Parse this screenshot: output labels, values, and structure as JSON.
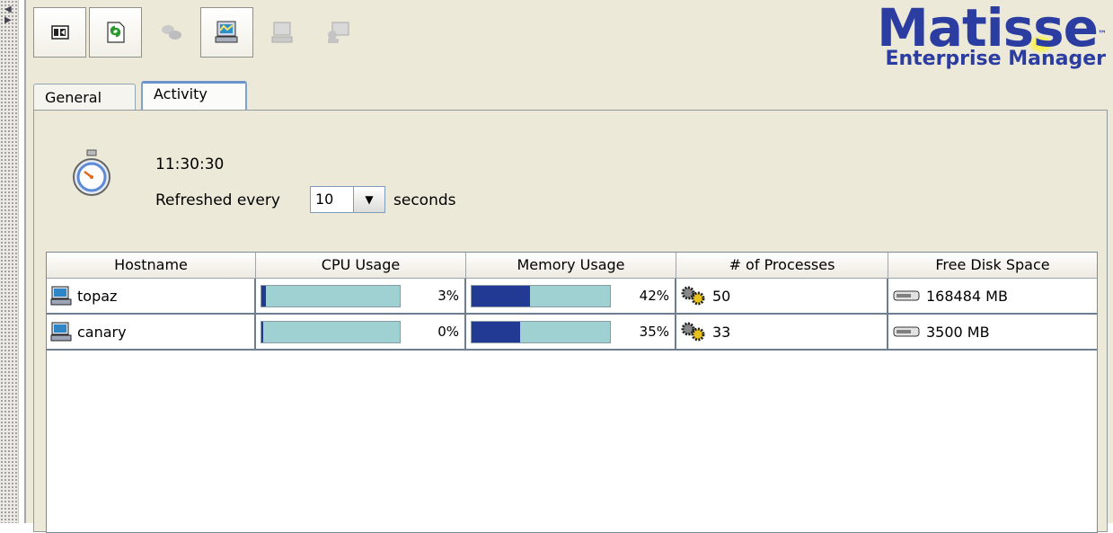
{
  "toolbar": {
    "buttons": [
      {
        "icon": "toggle-panel-icon",
        "enabled": true
      },
      {
        "icon": "refresh-icon",
        "enabled": true
      },
      {
        "icon": "disconnect-icon",
        "enabled": false
      },
      {
        "icon": "host-activity-icon",
        "enabled": true
      },
      {
        "icon": "host-icon",
        "enabled": false
      },
      {
        "icon": "host-users-icon",
        "enabled": false
      }
    ]
  },
  "logo": {
    "name": "Matisse",
    "subtitle": "Enterprise Manager",
    "color": "#2b3da0"
  },
  "tabs": {
    "general": "General",
    "activity": "Activity"
  },
  "activity": {
    "time": "11:30:30",
    "refresh_label": "Refreshed every",
    "refresh_value": "10",
    "seconds_label": "seconds"
  },
  "table": {
    "headers": {
      "hostname": "Hostname",
      "cpu": "CPU Usage",
      "memory": "Memory Usage",
      "processes": "# of Processes",
      "disk": "Free Disk Space"
    },
    "rows": [
      {
        "hostname": "topaz",
        "cpu_pct": 3,
        "cpu_text": "3%",
        "mem_pct": 42,
        "mem_text": "42%",
        "processes": "50",
        "disk": "168484 MB"
      },
      {
        "hostname": "canary",
        "cpu_pct": 0,
        "cpu_text": "0%",
        "mem_pct": 35,
        "mem_text": "35%",
        "processes": "33",
        "disk": "3500 MB"
      }
    ]
  },
  "colors": {
    "bar_fill": "#223a93",
    "bar_track": "#9fd0d2",
    "panel_bg": "#ece9d8"
  }
}
